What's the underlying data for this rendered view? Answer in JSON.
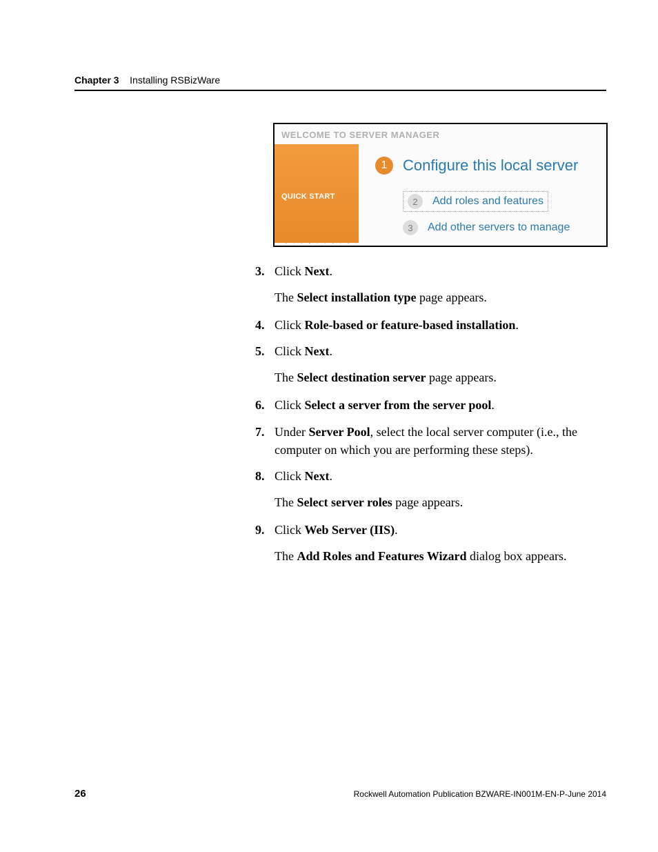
{
  "header": {
    "chapter": "Chapter 3",
    "title": "Installing RSBizWare"
  },
  "figure": {
    "title": "WELCOME TO SERVER MANAGER",
    "quick_start": "QUICK START",
    "row1": {
      "num": "1",
      "text": "Configure this local server"
    },
    "row2": {
      "num": "2",
      "text": "Add roles and features"
    },
    "row3": {
      "num": "3",
      "text": "Add other servers to manage"
    }
  },
  "steps": {
    "s3": {
      "num": "3.",
      "pre": "Click ",
      "bold": "Next",
      "post": "."
    },
    "s3f": {
      "pre": "The ",
      "bold": "Select installation type",
      "post": " page appears."
    },
    "s4": {
      "num": "4.",
      "pre": "Click ",
      "bold": "Role-based or feature-based installation",
      "post": "."
    },
    "s5": {
      "num": "5.",
      "pre": "Click ",
      "bold": "Next",
      "post": "."
    },
    "s5f": {
      "pre": "The ",
      "bold": "Select destination server",
      "post": " page appears."
    },
    "s6": {
      "num": "6.",
      "pre": "Click ",
      "bold": "Select a server from the server pool",
      "post": "."
    },
    "s7": {
      "num": "7.",
      "pre": "Under ",
      "bold": "Server Pool",
      "post": ", select the local server computer (i.e., the computer on which you are performing these steps)."
    },
    "s8": {
      "num": "8.",
      "pre": "Click ",
      "bold": "Next",
      "post": "."
    },
    "s8f": {
      "pre": "The ",
      "bold": "Select server roles",
      "post": " page appears."
    },
    "s9": {
      "num": "9.",
      "pre": "Click ",
      "bold": "Web Server (IIS)",
      "post": "."
    },
    "s9f": {
      "pre": "The ",
      "bold": "Add Roles and Features Wizard",
      "post": " dialog box appears."
    }
  },
  "footer": {
    "page": "26",
    "publication": "Rockwell Automation Publication BZWARE-IN001M-EN-P-June 2014"
  }
}
